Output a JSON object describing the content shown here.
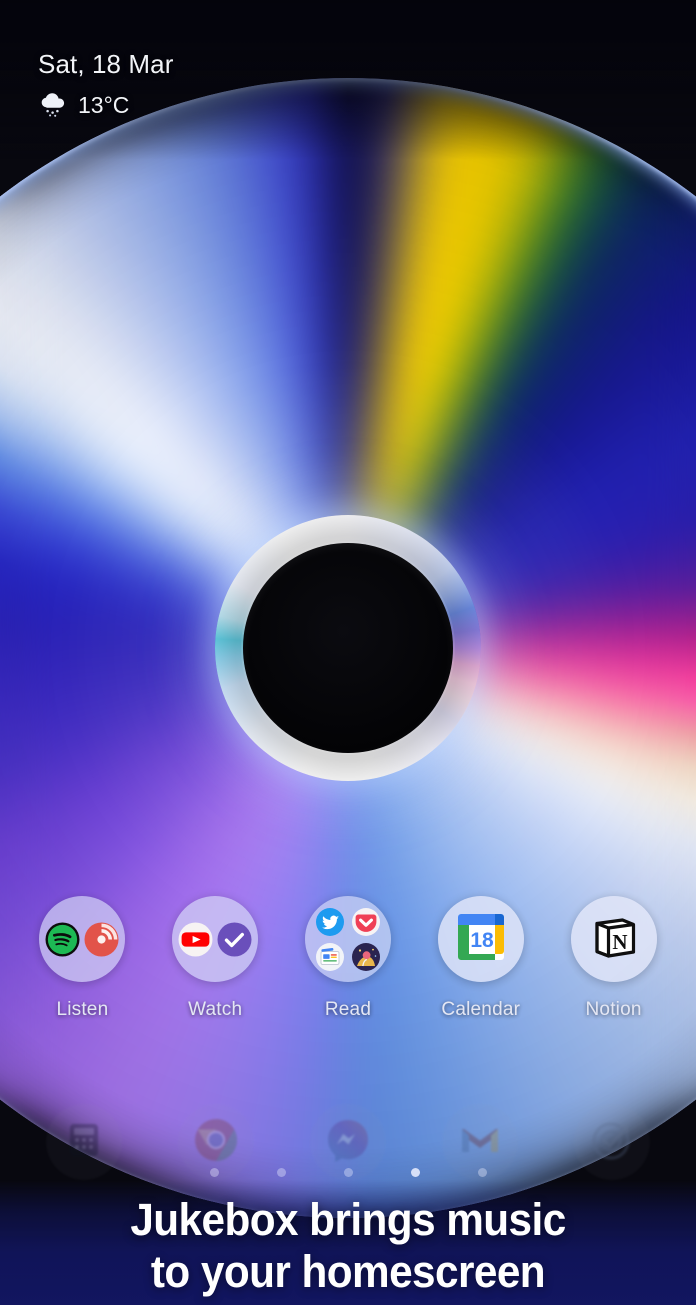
{
  "status": {
    "date": "Sat, 18 Mar",
    "temperature": "13°C",
    "weather_icon": "rain-cloud-icon"
  },
  "wallpaper": {
    "subject": "compact-disc",
    "background_color": "#08080f",
    "disc_colors": {
      "blue": "#2626d8",
      "yellow_ray": "#ffd400",
      "magenta_ray": "#ff3ca0",
      "violet": "#7a4fdc",
      "pale_blue": "#aac4f2",
      "white_ray": "#f4f6fe",
      "hub_hole": "#000000"
    }
  },
  "apps": [
    {
      "label": "Listen",
      "name": "app-listen",
      "type": "folder",
      "contents": [
        "spotify-icon",
        "pocket-casts-icon"
      ]
    },
    {
      "label": "Watch",
      "name": "app-watch",
      "type": "folder",
      "contents": [
        "youtube-icon",
        "check-circle-icon"
      ]
    },
    {
      "label": "Read",
      "name": "app-read",
      "type": "folder",
      "contents": [
        "twitter-icon",
        "pocket-icon",
        "google-news-icon",
        "book-app-icon"
      ]
    },
    {
      "label": "Calendar",
      "name": "app-calendar",
      "type": "app",
      "contents": [
        "google-calendar-icon"
      ],
      "badge_day": "18"
    },
    {
      "label": "Notion",
      "name": "app-notion",
      "type": "app",
      "contents": [
        "notion-icon"
      ]
    }
  ],
  "dock": [
    {
      "name": "dock-calculator",
      "icon": "calculator-icon"
    },
    {
      "name": "dock-chrome",
      "icon": "chrome-icon"
    },
    {
      "name": "dock-messenger",
      "icon": "messenger-icon"
    },
    {
      "name": "dock-gmail",
      "icon": "gmail-icon"
    },
    {
      "name": "dock-goals",
      "icon": "target-icon"
    }
  ],
  "page_indicator": {
    "count": 5,
    "active_index": 3
  },
  "caption": {
    "line1": "Jukebox brings music",
    "line2": "to your homescreen"
  }
}
